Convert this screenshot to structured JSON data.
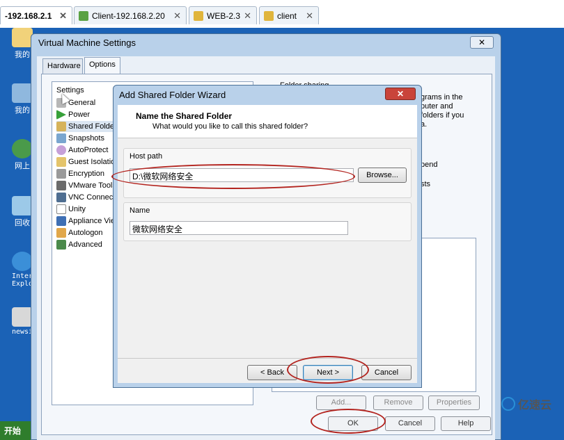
{
  "tabs": [
    {
      "label": "-192.168.2.1",
      "icon": "vm-icon",
      "active": true
    },
    {
      "label": "Client-192.168.2.20",
      "icon": "vm-icon"
    },
    {
      "label": "WEB-2.3",
      "icon": "vm-icon"
    },
    {
      "label": "client",
      "icon": "vm-icon"
    }
  ],
  "tab_close": "✕",
  "desktop": {
    "icons": [
      {
        "label": "我的",
        "icon": "folder-icon"
      },
      {
        "label": "我的",
        "icon": "computer-icon"
      },
      {
        "label": "网上",
        "icon": "network-icon"
      },
      {
        "label": "回收",
        "icon": "recycle-bin-icon"
      },
      {
        "label": "Inter Explo",
        "icon": "ie-icon"
      },
      {
        "label": "newsi",
        "icon": "app-icon"
      }
    ],
    "start_label": "开始",
    "watermark": "亿速云"
  },
  "vm_settings": {
    "title": "Virtual Machine Settings",
    "close": "✕",
    "tabs": [
      "Hardware",
      "Options"
    ],
    "settings_header": "Settings",
    "items": [
      {
        "label": "General",
        "icon": "general-icon"
      },
      {
        "label": "Power",
        "icon": "power-icon"
      },
      {
        "label": "Shared Folder",
        "icon": "shared-folder-icon"
      },
      {
        "label": "Snapshots",
        "icon": "snapshots-icon"
      },
      {
        "label": "AutoProtect",
        "icon": "autoprotect-icon"
      },
      {
        "label": "Guest Isolatio",
        "icon": "guest-isolation-icon"
      },
      {
        "label": "Encryption",
        "icon": "encryption-icon"
      },
      {
        "label": "VMware Tools",
        "icon": "vmware-tools-icon"
      },
      {
        "label": "VNC Connecti",
        "icon": "vnc-icon"
      },
      {
        "label": "Unity",
        "icon": "unity-icon"
      },
      {
        "label": "Appliance View",
        "icon": "appliance-view-icon"
      },
      {
        "label": "Autologon",
        "icon": "autologon-icon"
      },
      {
        "label": "Advanced",
        "icon": "advanced-icon"
      }
    ],
    "folder_sharing": "Folder sharing",
    "right_text_1": "grams in the",
    "right_text_2": "puter and",
    "right_text_3": "folders if you",
    "right_text_4": "a.",
    "right_text_5": "pend",
    "right_text_6": "sts",
    "add_btn": "Add...",
    "remove_btn": "Remove",
    "properties_btn": "Properties",
    "ok": "OK",
    "cancel": "Cancel",
    "help": "Help"
  },
  "wizard": {
    "title": "Add Shared Folder Wizard",
    "close": "✕",
    "heading": "Name the Shared Folder",
    "subheading": "What would you like to call this shared folder?",
    "host_path_label": "Host path",
    "host_path_value": "D:\\微软网络安全",
    "browse": "Browse...",
    "name_label": "Name",
    "name_value": "微软网络安全",
    "back": "< Back",
    "next": "Next >",
    "cancel": "Cancel"
  },
  "colors": {
    "desktop": "#1b62b6",
    "annotation": "#b3241f",
    "window_frame": "#b9d1ea"
  }
}
